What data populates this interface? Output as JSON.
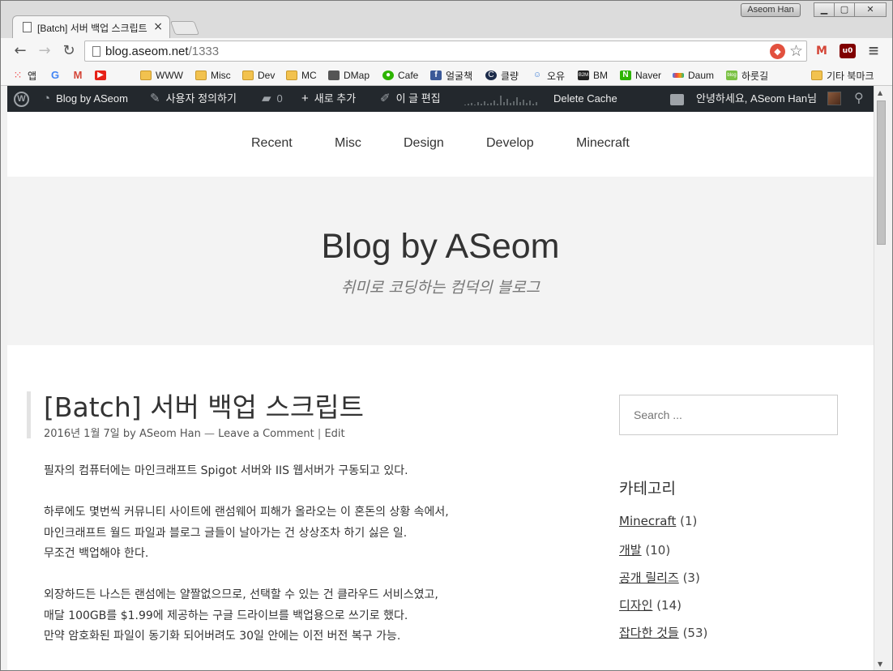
{
  "browser": {
    "tab_title": "[Batch] 서버 백업 스크립트",
    "tab_close": "×",
    "profile_name": "Aseom Han",
    "url_host": "blog.aseom.net",
    "url_path": "/1333"
  },
  "bookmarks": [
    {
      "label": "앱",
      "icon": "apps-icon"
    },
    {
      "label": "",
      "icon": "google-icon"
    },
    {
      "label": "",
      "icon": "gmail-icon"
    },
    {
      "label": "",
      "icon": "youtube-icon"
    },
    {
      "label": "WWW",
      "icon": "folder-icon"
    },
    {
      "label": "Misc",
      "icon": "folder-icon"
    },
    {
      "label": "Dev",
      "icon": "folder-icon"
    },
    {
      "label": "MC",
      "icon": "folder-icon"
    },
    {
      "label": "DMap",
      "icon": "cube-icon"
    },
    {
      "label": "Cafe",
      "icon": "cafe-icon"
    },
    {
      "label": "얼굴책",
      "icon": "facebook-icon"
    },
    {
      "label": "클량",
      "icon": "clien-icon"
    },
    {
      "label": "오유",
      "icon": "todayhumor-icon"
    },
    {
      "label": "BM",
      "icon": "bm-icon"
    },
    {
      "label": "Naver",
      "icon": "naver-icon"
    },
    {
      "label": "Daum",
      "icon": "daum-icon"
    },
    {
      "label": "하룻길",
      "icon": "blog-icon"
    },
    {
      "label": "기타 북마크",
      "icon": "folder-icon"
    }
  ],
  "adminbar": {
    "site_name": "Blog by ASeom",
    "customize": "사용자 정의하기",
    "comments_count": "0",
    "new_item": "새로 추가",
    "edit_post": "이 글 편집",
    "delete_cache": "Delete Cache",
    "greeting": "안녕하세요, ASeom Han님"
  },
  "nav": [
    "Recent",
    "Misc",
    "Design",
    "Develop",
    "Minecraft"
  ],
  "site": {
    "title": "Blog by ASeom",
    "description": "취미로 코딩하는 컴덕의 블로그"
  },
  "post": {
    "title": "[Batch] 서버 백업 스크립트",
    "date": "2016년 1월 7일",
    "by": "by",
    "author": "ASeom Han",
    "dash": "—",
    "comment_link": "Leave a Comment",
    "pipe": "|",
    "edit_link": "Edit",
    "paragraphs": [
      [
        "필자의 컴퓨터에는 마인크래프트 Spigot 서버와 IIS 웹서버가 구동되고 있다."
      ],
      [
        "하루에도 몇번씩 커뮤니티 사이트에 랜섬웨어 피해가 올라오는 이 혼돈의 상황 속에서,",
        "마인크래프트 월드 파일과 블로그 글들이 날아가는 건 상상조차 하기 싫은 일.",
        "무조건 백업해야 한다."
      ],
      [
        "외장하드든 나스든 랜섬에는 얄짤없으므로, 선택할 수 있는 건 클라우드 서비스였고,",
        "매달 100GB를 $1.99에 제공하는 구글 드라이브를 백업용으로 쓰기로 했다.",
        "만약 암호화된 파일이 동기화 되어버려도 30일 안에는 이전 버전 복구 가능."
      ]
    ]
  },
  "sidebar": {
    "search_placeholder": "Search ...",
    "categories_title": "카테고리",
    "categories": [
      {
        "name": "Minecraft",
        "count": "(1)"
      },
      {
        "name": "개발",
        "count": "(10)"
      },
      {
        "name": "공개 릴리즈",
        "count": "(3)"
      },
      {
        "name": "디자인",
        "count": "(14)"
      },
      {
        "name": "잡다한 것들",
        "count": "(53)"
      }
    ]
  },
  "colors": {
    "adminbar_bg": "#23282d",
    "hero_bg": "#f3f3f3",
    "accent_red": "#e2503e"
  }
}
